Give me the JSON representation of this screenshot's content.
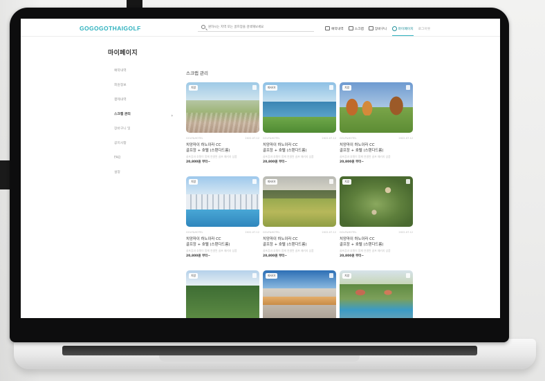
{
  "colors": {
    "accent": "#2bb0bd",
    "accent_dark": "#1e8f9a"
  },
  "header": {
    "logo": "GOGOGOTHAIGOLF",
    "search_placeholder": "원하시는 지역 또는 골프장을 검색해보세요",
    "nav": [
      {
        "label": "예약내역",
        "icon": "calendar-icon"
      },
      {
        "label": "스크랩",
        "icon": "bookmark-icon"
      },
      {
        "label": "장바구니",
        "icon": "cart-icon"
      },
      {
        "label": "마이페이지",
        "icon": "user-icon"
      },
      {
        "label": "로그아웃",
        "icon": ""
      }
    ]
  },
  "page_title": "마이페이지",
  "sidebar": {
    "items": [
      {
        "label": "예약내역"
      },
      {
        "label": "회원정보"
      },
      {
        "label": "결제내역"
      },
      {
        "label": "스크랩 관리"
      },
      {
        "label": "장바구니 및"
      },
      {
        "label": "공지사항"
      },
      {
        "label": "FAQ"
      },
      {
        "label": "설정"
      }
    ],
    "active_chevron": "›"
  },
  "main": {
    "section_title": "스크랩 관리",
    "cards": [
      {
        "badge": "치앙",
        "meta_left": "GOLF&HOTEL",
        "meta_right": "2022.07.12",
        "title": "치앙마이 하노이라 CC",
        "sub": "골프장 + 호텔 (스탠다드룸)",
        "desc": "골프장과 호텔이 함께 연결된 골프 패키지 상품",
        "price": "20,800원 부터~"
      },
      {
        "badge": "파타야",
        "meta_left": "GOLF&HOTEL",
        "meta_right": "2022.07.12",
        "title": "치앙마이 하노이라 CC",
        "sub": "골프장 + 호텔 (스탠다드룸)",
        "desc": "골프장과 호텔이 함께 연결된 골프 패키지 상품",
        "price": "20,800원 부터~"
      },
      {
        "badge": "치앙",
        "meta_left": "GOLF&HOTEL",
        "meta_right": "2022.07.12",
        "title": "치앙마이 하노이라 CC",
        "sub": "골프장 + 호텔 (스탠다드룸)",
        "desc": "골프장과 호텔이 함께 연결된 골프 패키지 상품",
        "price": "20,800원 부터~"
      },
      {
        "badge": "치앙",
        "meta_left": "GOLF&HOTEL",
        "meta_right": "2022.07.12",
        "title": "치앙마이 하노이라 CC",
        "sub": "골프장 + 호텔 (스탠다드룸)",
        "desc": "골프장과 호텔이 함께 연결된 골프 패키지 상품",
        "price": "20,800원 부터~"
      },
      {
        "badge": "파타야",
        "meta_left": "GOLF&HOTEL",
        "meta_right": "2022.07.12",
        "title": "치앙마이 하노이라 CC",
        "sub": "골프장 + 호텔 (스탠다드룸)",
        "desc": "골프장과 호텔이 함께 연결된 골프 패키지 상품",
        "price": "20,800원 부터~"
      },
      {
        "badge": "치앙",
        "meta_left": "GOLF&HOTEL",
        "meta_right": "2022.07.12",
        "title": "치앙마이 하노이라 CC",
        "sub": "골프장 + 호텔 (스탠다드룸)",
        "desc": "골프장과 호텔이 함께 연결된 골프 패키지 상품",
        "price": "20,800원 부터~"
      },
      {
        "badge": "치앙",
        "meta_left": "",
        "meta_right": "",
        "title": "",
        "sub": "",
        "desc": "",
        "price": ""
      },
      {
        "badge": "파타야",
        "meta_left": "",
        "meta_right": "",
        "title": "",
        "sub": "",
        "desc": "",
        "price": ""
      },
      {
        "badge": "치앙",
        "meta_left": "",
        "meta_right": "",
        "title": "",
        "sub": "",
        "desc": "",
        "price": ""
      }
    ]
  }
}
